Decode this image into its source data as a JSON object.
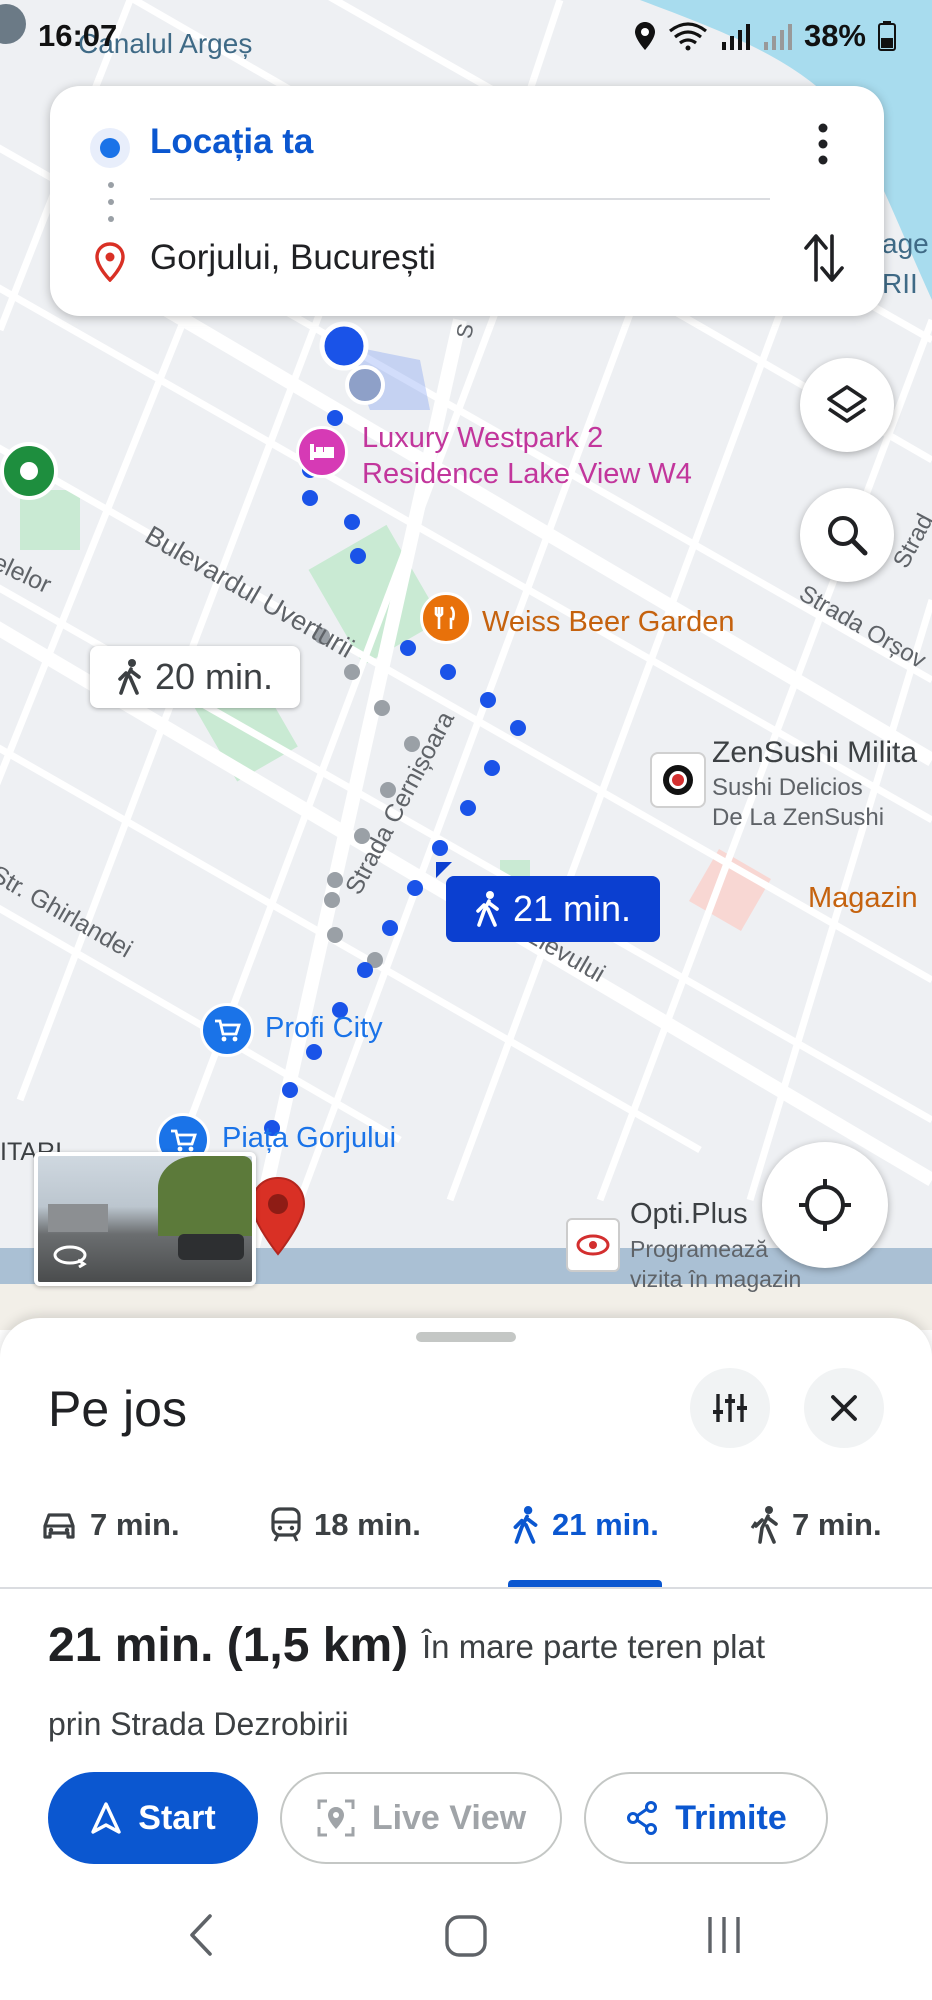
{
  "status_bar": {
    "time": "16:07",
    "battery": "38%"
  },
  "search": {
    "origin": "Locația ta",
    "destination": "Gorjului, București"
  },
  "map": {
    "labels": {
      "canal": "Canalul Argeș",
      "hotel_line1": "Luxury Westpark 2",
      "hotel_line2": "Residence Lake View W4",
      "bulevard": "Bulevardul Uverturii",
      "restaurant": "Weiss Beer Garden",
      "sushi_title": "ZenSushi Milita",
      "sushi_line1": "Sushi Delicios",
      "sushi_line2": "De La ZenSushi",
      "magazin": "Magazin",
      "strada_cernisoara": "Strada Cernișoara",
      "ghirlandei": "Str. Ghirlandei",
      "elevului": "Elevului",
      "profi": "Profi City",
      "piata": "Piața Gorjului",
      "opti_title": "Opti.Plus",
      "opti_line1": "Programează",
      "opti_line2": "vizita în magazin",
      "strada_orsova": "Strada Orșov",
      "elelor": "elelor",
      "age": "age",
      "rii": "RII",
      "itari": "ITARI",
      "s_label": "S",
      "strad": "Strad"
    },
    "route_bubble_alt": "20 min.",
    "route_bubble_main": "21 min."
  },
  "sheet": {
    "title": "Pe jos",
    "tabs": [
      {
        "icon": "car-icon",
        "label": "7 min."
      },
      {
        "icon": "transit-icon",
        "label": "18 min."
      },
      {
        "icon": "walk-icon",
        "label": "21 min."
      },
      {
        "icon": "rideshare-icon",
        "label": "7 min."
      }
    ],
    "summary_time": "21 min. (1,5 km)",
    "summary_terrain": "În mare parte teren plat",
    "via": "prin Strada Dezrobirii",
    "buttons": {
      "start": "Start",
      "live_view": "Live View",
      "share": "Trimite"
    }
  },
  "colors": {
    "accent_blue": "#0b57d0",
    "route_bubble_blue": "#0b3fd0",
    "destination_red": "#d93025",
    "hotel_pink": "#d63ab5",
    "food_orange": "#e8710a",
    "shop_blue": "#1a73e8",
    "water": "#a8dcee"
  }
}
